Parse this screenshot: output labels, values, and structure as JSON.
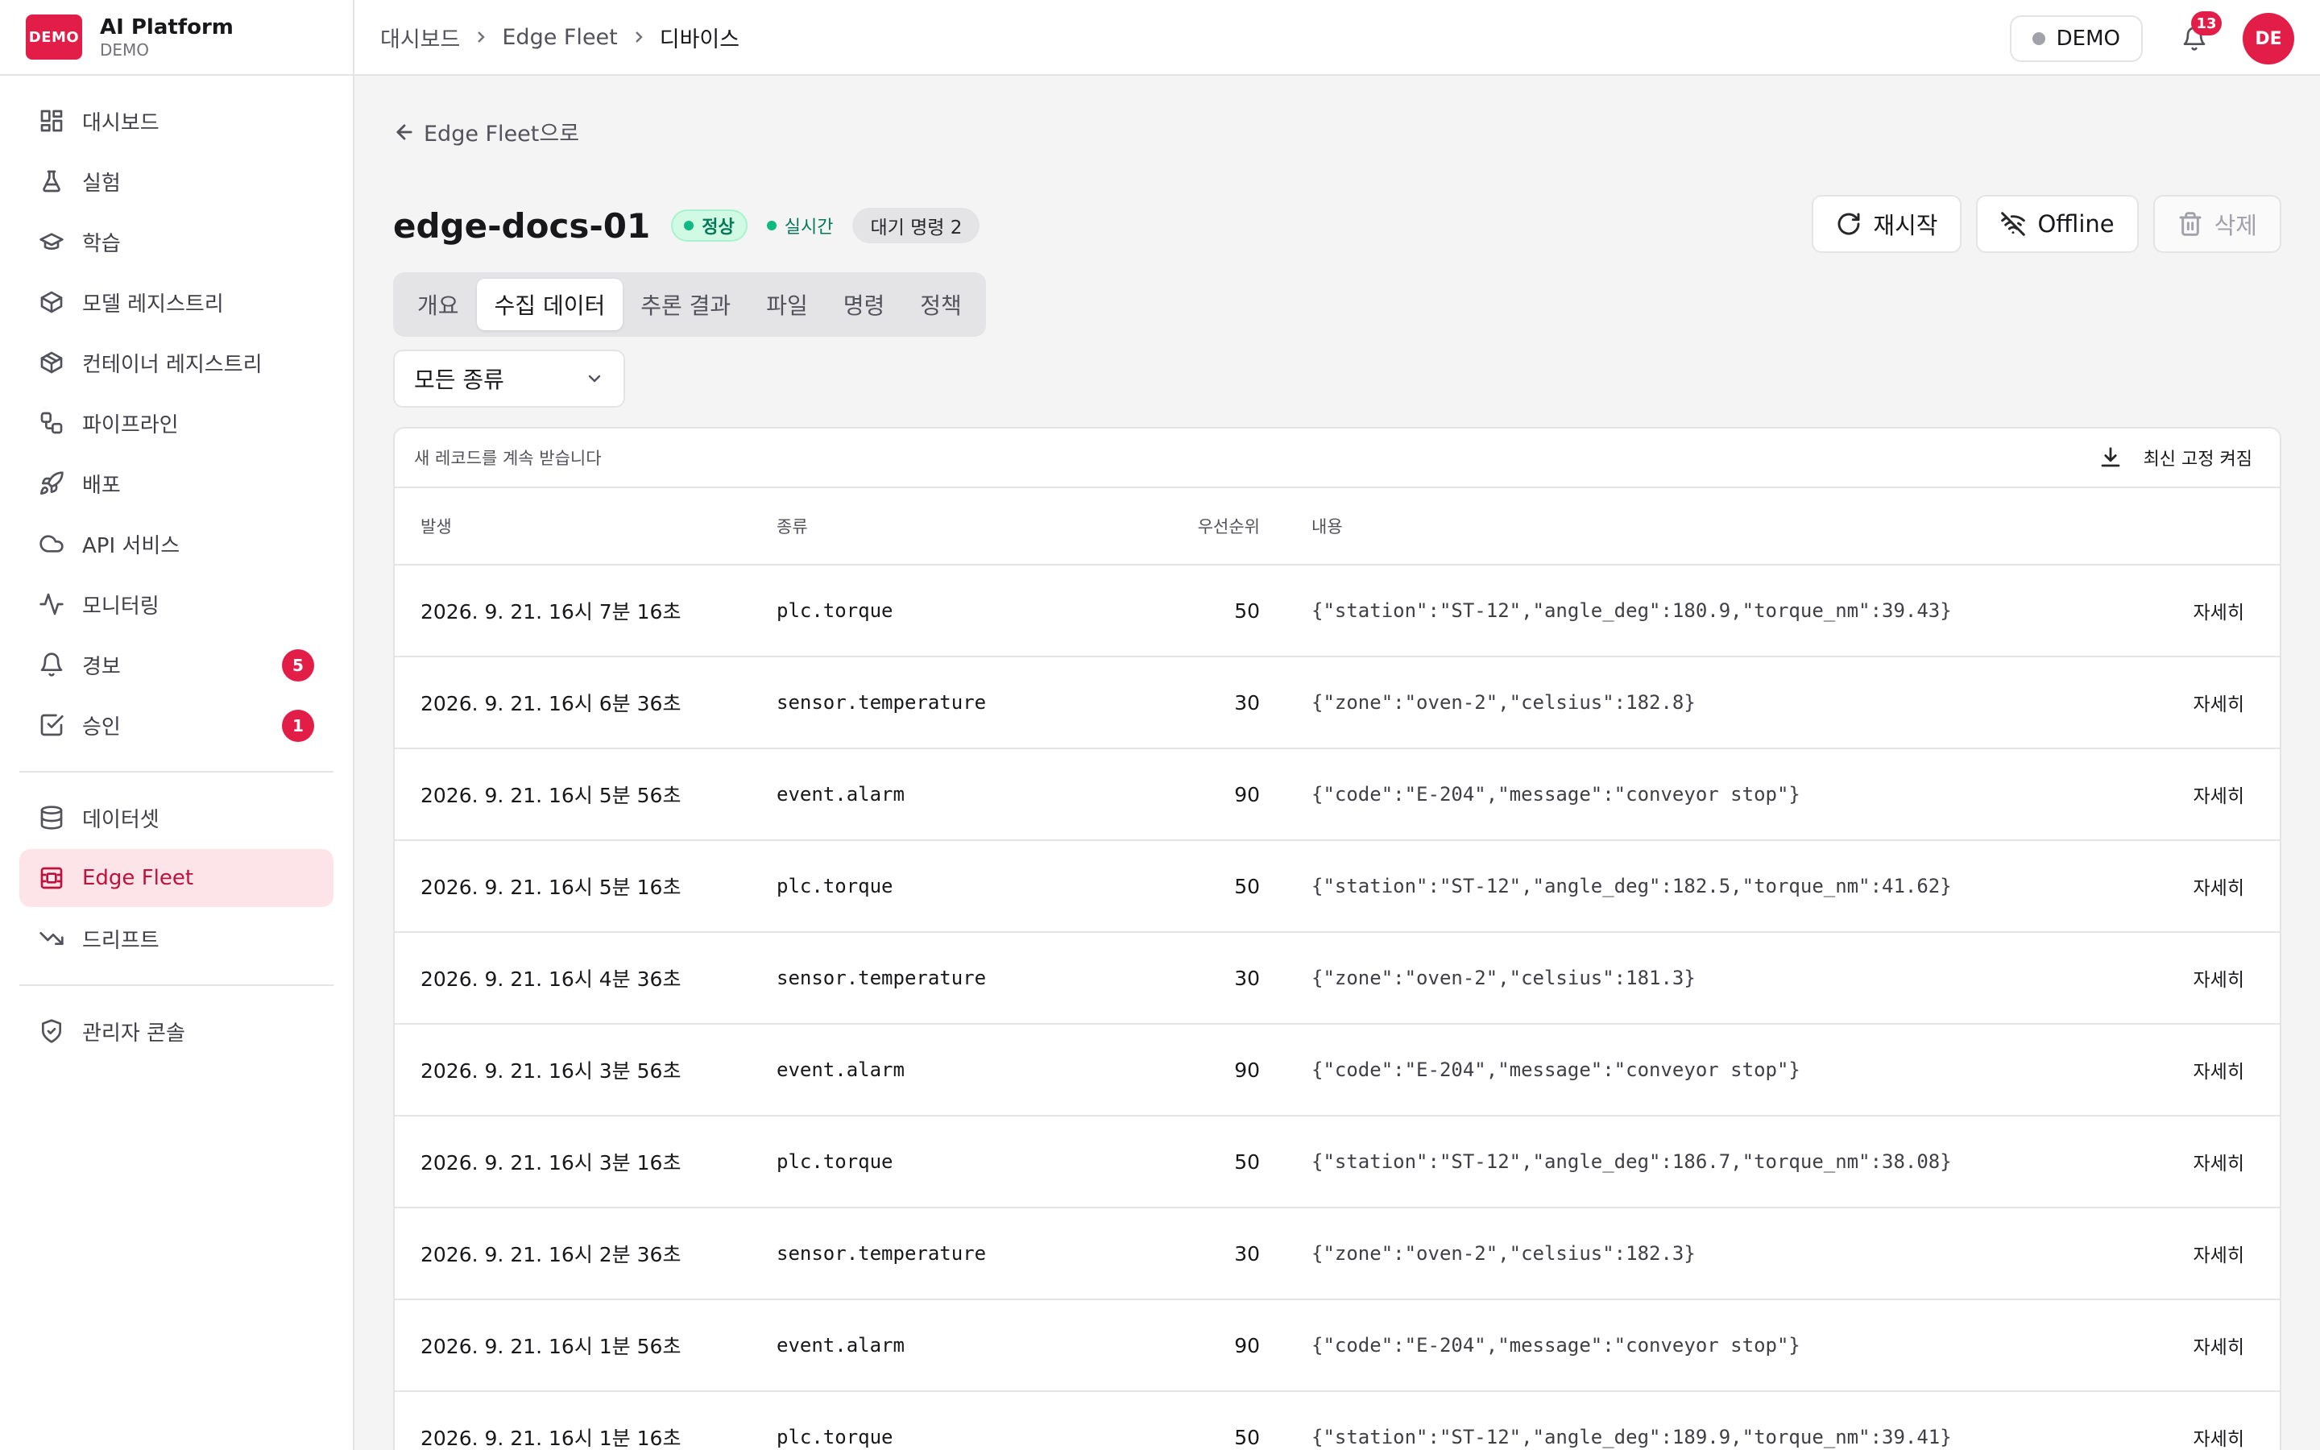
{
  "brand": {
    "logo": "DEMO",
    "title": "AI Platform",
    "subtitle": "DEMO"
  },
  "sidebar": {
    "groups": [
      {
        "items": [
          {
            "label": "대시보드",
            "icon": "dashboard-icon"
          },
          {
            "label": "실험",
            "icon": "flask-icon"
          },
          {
            "label": "학습",
            "icon": "graduation-cap-icon"
          },
          {
            "label": "모델 레지스트리",
            "icon": "box-icon"
          },
          {
            "label": "컨테이너 레지스트리",
            "icon": "container-icon"
          },
          {
            "label": "파이프라인",
            "icon": "workflow-icon"
          },
          {
            "label": "배포",
            "icon": "rocket-icon"
          },
          {
            "label": "API 서비스",
            "icon": "cloud-icon"
          },
          {
            "label": "모니터링",
            "icon": "activity-icon"
          },
          {
            "label": "경보",
            "icon": "bell-icon",
            "badge": "5"
          },
          {
            "label": "승인",
            "icon": "check-square-icon",
            "badge": "1"
          }
        ]
      },
      {
        "items": [
          {
            "label": "데이터셋",
            "icon": "database-icon"
          },
          {
            "label": "Edge Fleet",
            "icon": "edge-fleet-icon",
            "active": true
          },
          {
            "label": "드리프트",
            "icon": "trending-down-icon"
          }
        ]
      },
      {
        "items": [
          {
            "label": "관리자 콘솔",
            "icon": "shield-check-icon"
          }
        ]
      }
    ]
  },
  "topbar": {
    "breadcrumb": [
      "대시보드",
      "Edge Fleet",
      "디바이스"
    ],
    "env_label": "DEMO",
    "notification_count": "13",
    "avatar_initials": "DE"
  },
  "page": {
    "back_label": "Edge Fleet으로",
    "device_name": "edge-docs-01",
    "status": "정상",
    "live_label": "실시간",
    "pending_commands": "대기 명령 2",
    "actions": {
      "restart": "재시작",
      "offline": "Offline",
      "delete": "삭제"
    },
    "tabs": [
      "개요",
      "수집 데이터",
      "추론 결과",
      "파일",
      "명령",
      "정책"
    ],
    "active_tab": "수집 데이터",
    "filter_value": "모든 종류"
  },
  "table": {
    "stream_note": "새 레코드를 계속 받습니다",
    "pin_toggle_label": "최신 고정 켜짐",
    "columns": {
      "time": "발생",
      "kind": "종류",
      "priority": "우선순위",
      "body": "내용"
    },
    "detail_label": "자세히",
    "rows": [
      {
        "time": "2026. 9. 21. 16시 7분 16초",
        "kind": "plc.torque",
        "priority": "50",
        "body": "{\"station\":\"ST-12\",\"angle_deg\":180.9,\"torque_nm\":39.43}"
      },
      {
        "time": "2026. 9. 21. 16시 6분 36초",
        "kind": "sensor.temperature",
        "priority": "30",
        "body": "{\"zone\":\"oven-2\",\"celsius\":182.8}"
      },
      {
        "time": "2026. 9. 21. 16시 5분 56초",
        "kind": "event.alarm",
        "priority": "90",
        "body": "{\"code\":\"E-204\",\"message\":\"conveyor stop\"}"
      },
      {
        "time": "2026. 9. 21. 16시 5분 16초",
        "kind": "plc.torque",
        "priority": "50",
        "body": "{\"station\":\"ST-12\",\"angle_deg\":182.5,\"torque_nm\":41.62}"
      },
      {
        "time": "2026. 9. 21. 16시 4분 36초",
        "kind": "sensor.temperature",
        "priority": "30",
        "body": "{\"zone\":\"oven-2\",\"celsius\":181.3}"
      },
      {
        "time": "2026. 9. 21. 16시 3분 56초",
        "kind": "event.alarm",
        "priority": "90",
        "body": "{\"code\":\"E-204\",\"message\":\"conveyor stop\"}"
      },
      {
        "time": "2026. 9. 21. 16시 3분 16초",
        "kind": "plc.torque",
        "priority": "50",
        "body": "{\"station\":\"ST-12\",\"angle_deg\":186.7,\"torque_nm\":38.08}"
      },
      {
        "time": "2026. 9. 21. 16시 2분 36초",
        "kind": "sensor.temperature",
        "priority": "30",
        "body": "{\"zone\":\"oven-2\",\"celsius\":182.3}"
      },
      {
        "time": "2026. 9. 21. 16시 1분 56초",
        "kind": "event.alarm",
        "priority": "90",
        "body": "{\"code\":\"E-204\",\"message\":\"conveyor stop\"}"
      },
      {
        "time": "2026. 9. 21. 16시 1분 16초",
        "kind": "plc.torque",
        "priority": "50",
        "body": "{\"station\":\"ST-12\",\"angle_deg\":189.9,\"torque_nm\":39.41}"
      }
    ]
  },
  "colors": {
    "accent": "#e11d48",
    "active_nav_bg": "#fde4e9",
    "status_green": "#10b981"
  }
}
